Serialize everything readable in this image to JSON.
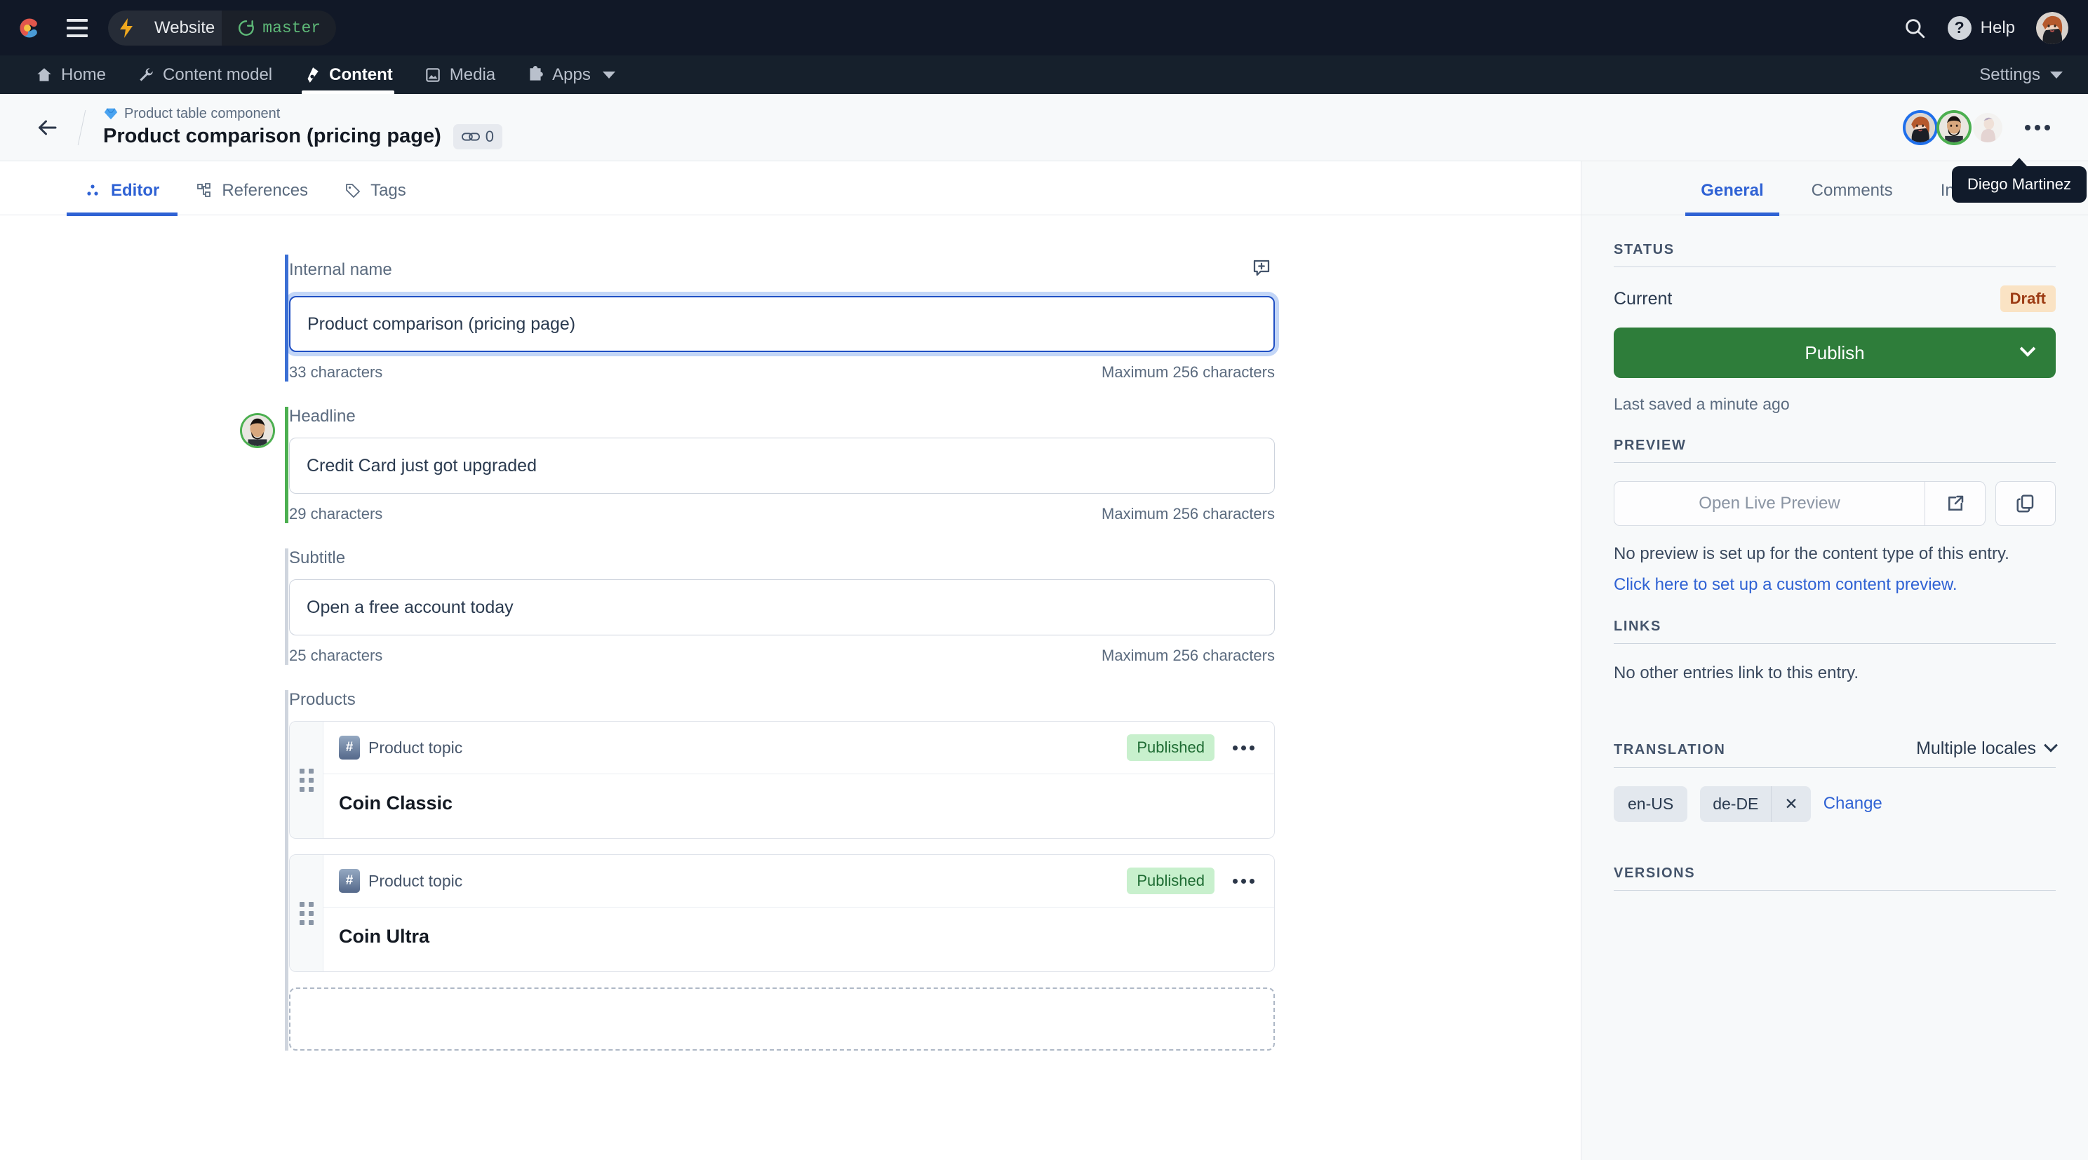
{
  "topbar": {
    "logo": "contentful-logo",
    "menu_icon": "hamburger-menu-icon",
    "bolt_icon": "lightning-bolt-icon",
    "space_name": "Website",
    "branch_icon": "git-branch-icon",
    "branch_name": "master",
    "search_icon": "search-icon",
    "help_icon": "question-mark-icon",
    "help_label": "Help",
    "avatar": "user-avatar"
  },
  "nav": {
    "items": [
      {
        "label": "Home",
        "icon": "home-icon",
        "active": false
      },
      {
        "label": "Content model",
        "icon": "wrench-icon",
        "active": false
      },
      {
        "label": "Content",
        "icon": "pen-nib-icon",
        "active": true
      },
      {
        "label": "Media",
        "icon": "image-icon",
        "active": false
      },
      {
        "label": "Apps",
        "icon": "puzzle-icon",
        "active": false,
        "has_caret": true
      }
    ],
    "settings_label": "Settings"
  },
  "entry_header": {
    "back_icon": "back-arrow-icon",
    "content_type_icon": "gem-icon",
    "content_type": "Product table component",
    "title": "Product comparison (pricing page)",
    "link_icon": "chain-link-icon",
    "link_count": "0",
    "more_icon": "more-options-icon",
    "tooltip": "Diego Martinez"
  },
  "tabs": [
    {
      "label": "Editor",
      "icon": "editor-dots-icon",
      "active": true
    },
    {
      "label": "References",
      "icon": "references-hierarchy-icon",
      "active": false
    },
    {
      "label": "Tags",
      "icon": "tag-icon",
      "active": false
    }
  ],
  "fields": [
    {
      "label": "Internal name",
      "value": "Product comparison (pricing page)",
      "char_count": "33 characters",
      "max_chars": "Maximum 256 characters",
      "bar": "blue",
      "focused": true,
      "comment_icon": "add-comment-icon"
    },
    {
      "label": "Headline",
      "value": "Credit Card just got upgraded",
      "char_count": "29 characters",
      "max_chars": "Maximum 256 characters",
      "bar": "green",
      "focused": false,
      "collaborator_avatar": "collaborator-avatar"
    },
    {
      "label": "Subtitle",
      "value": "Open a free account today",
      "char_count": "25 characters",
      "max_chars": "Maximum 256 characters",
      "bar": "grey",
      "focused": false
    }
  ],
  "products": {
    "label": "Products",
    "cards": [
      {
        "content_type": "Product topic",
        "content_type_icon": "hash-icon",
        "status": "Published",
        "title": "Coin Classic",
        "drag_handle": "drag-handle-icon",
        "more_icon": "card-more-options-icon"
      },
      {
        "content_type": "Product topic",
        "content_type_icon": "hash-icon",
        "status": "Published",
        "title": "Coin Ultra",
        "drag_handle": "drag-handle-icon",
        "more_icon": "card-more-options-icon"
      }
    ]
  },
  "sidebar": {
    "tabs": [
      {
        "label": "General",
        "active": true
      },
      {
        "label": "Comments",
        "active": false
      },
      {
        "label": "Info",
        "active": false
      }
    ],
    "status": {
      "heading": "STATUS",
      "current_label": "Current",
      "current_value": "Draft",
      "publish_label": "Publish",
      "publish_chevron": "chevron-down-icon",
      "last_saved": "Last saved a minute ago"
    },
    "preview": {
      "heading": "PREVIEW",
      "button_label": "Open Live Preview",
      "external_icon": "external-link-icon",
      "copy_icon": "copy-icon",
      "note": "No preview is set up for the content type of this entry.",
      "setup_link": "Click here to set up a custom content preview."
    },
    "links": {
      "heading": "LINKS",
      "empty_text": "No other entries link to this entry."
    },
    "translation": {
      "heading": "TRANSLATION",
      "selector_value": "Multiple locales",
      "selector_chevron": "chevron-down-icon",
      "locales": [
        {
          "code": "en-US",
          "removable": false
        },
        {
          "code": "de-DE",
          "removable": true,
          "remove_icon": "close-icon"
        }
      ],
      "change_label": "Change"
    },
    "versions": {
      "heading": "VERSIONS"
    }
  },
  "colors": {
    "accent_blue": "#2f62d4",
    "publish_green": "#2e7d3a",
    "draft_orange": "#fae3c4",
    "published_green": "#c8f0cd",
    "topbar_dark": "#111827",
    "nav_dark": "#16202c"
  }
}
